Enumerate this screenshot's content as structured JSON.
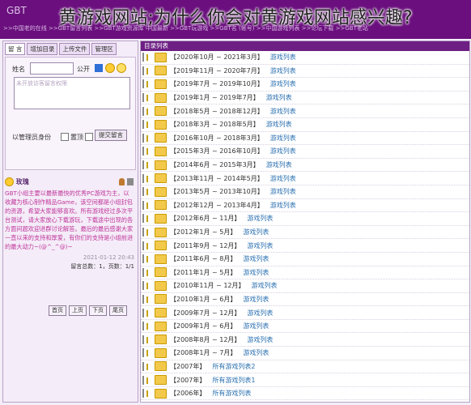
{
  "overlay_title": "黄游戏网站;为什么你会对黄游戏网站感兴趣?",
  "site_brand": "GBT",
  "marquee_text": ">>中国老的在线 >>GBT留言列表 >>GBT游戏资源库 中国最新 >>GBT玩游戏 >>GBT名 (帐号) >>中国游戏列表 >>论坛下载 >>GBT老站",
  "left_panel": {
    "tabs": [
      "留 言",
      "增加目录",
      "上传文件",
      "管理区"
    ],
    "name_label": "姓名",
    "public_label": "公开",
    "textarea_placeholder": "未开放访客留言权限",
    "admin_label": "以管理员身份",
    "pin_label": "置顶",
    "submit_label": "提交留言",
    "message": {
      "author": "玫瑰",
      "body": "GBT小组主要以最新最快的优秀PC游戏为主，以收藏为核心制作精品Game，该空间都是小组封包的资源，希望大家能够喜欢。所有游戏经过多次平台测试，请大家放心下载游玩，下载途中出现的各方面问题欢迎进群讨论解答。最后的最后感谢大家一直以来的支持和厚爱，有你们的支持是小组前进的最大动力~(@^_^@)~",
      "date": "2021-01-12 20:43",
      "stats": "留言总数：1，页数：1/1"
    },
    "pager": [
      "首页",
      "上页",
      "下页",
      "尾页"
    ]
  },
  "right_panel": {
    "header": "目录列表",
    "rows": [
      {
        "range": "【2020年10月 ~ 2021年3月】",
        "link": "游戏列表"
      },
      {
        "range": "【2019年11月 ~ 2020年7月】",
        "link": "游戏列表"
      },
      {
        "range": "【2019年7月 ~ 2019年10月】",
        "link": "游戏列表"
      },
      {
        "range": "【2019年1月 ~ 2019年7月】",
        "link": "游戏列表"
      },
      {
        "range": "【2018年5月 ~ 2018年12月】",
        "link": "游戏列表"
      },
      {
        "range": "【2018年3月 ~ 2018年5月】",
        "link": "游戏列表"
      },
      {
        "range": "【2016年10月 ~ 2018年3月】",
        "link": "游戏列表"
      },
      {
        "range": "【2015年3月 ~ 2016年10月】",
        "link": "游戏列表"
      },
      {
        "range": "【2014年6月 ~ 2015年3月】",
        "link": "游戏列表"
      },
      {
        "range": "【2013年11月 ~ 2014年5月】",
        "link": "游戏列表"
      },
      {
        "range": "【2013年5月 ~ 2013年10月】",
        "link": "游戏列表"
      },
      {
        "range": "【2012年12月 ~ 2013年4月】",
        "link": "游戏列表"
      },
      {
        "range": "【2012年6月 ~ 11月】",
        "link": "游戏列表"
      },
      {
        "range": "【2012年1月 ~ 5月】",
        "link": "游戏列表"
      },
      {
        "range": "【2011年9月 ~ 12月】",
        "link": "游戏列表"
      },
      {
        "range": "【2011年6月 ~ 8月】",
        "link": "游戏列表"
      },
      {
        "range": "【2011年1月 ~ 5月】",
        "link": "游戏列表"
      },
      {
        "range": "【2010年11月 ~ 12月】",
        "link": "游戏列表"
      },
      {
        "range": "【2010年1月 ~ 6月】",
        "link": "游戏列表"
      },
      {
        "range": "【2009年7月 ~ 12月】",
        "link": "游戏列表"
      },
      {
        "range": "【2009年1月 ~ 6月】",
        "link": "游戏列表"
      },
      {
        "range": "【2008年8月 ~ 12月】",
        "link": "游戏列表"
      },
      {
        "range": "【2008年1月 ~ 7月】",
        "link": "游戏列表"
      },
      {
        "range": "【2007年】",
        "link": "所有游戏列表2"
      },
      {
        "range": "【2007年】",
        "link": "所有游戏列表1"
      },
      {
        "range": "【2006年】",
        "link": "所有游戏列表"
      }
    ]
  }
}
